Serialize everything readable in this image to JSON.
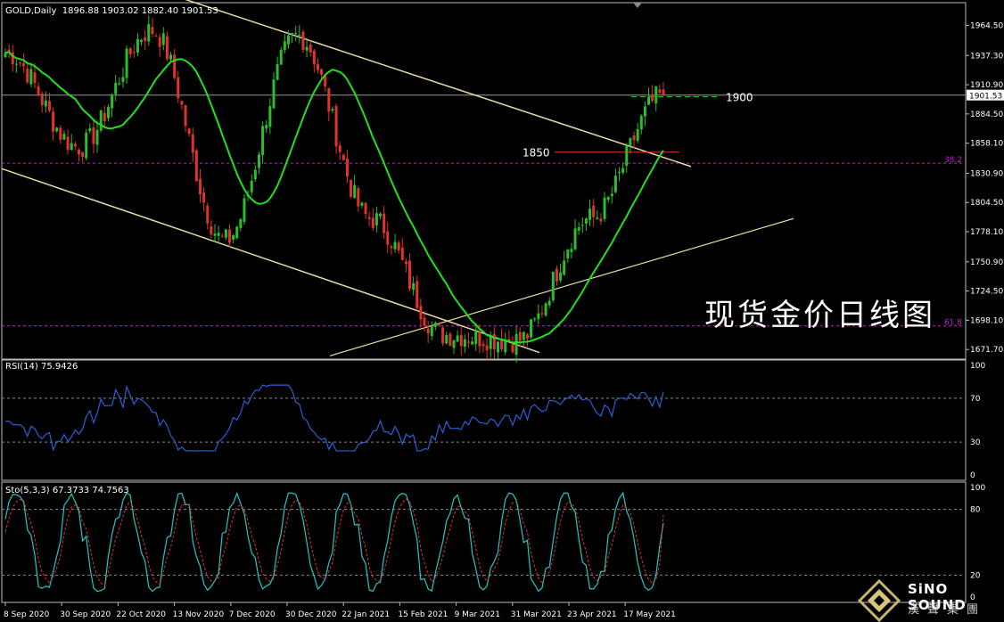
{
  "header": {
    "main": "GOLD,Daily  1896.88 1903.02 1882.40 1901.53",
    "rsi": "RSI(14) 75.9426",
    "sto": "Sto(5,3,3) 67.3733 74.7563"
  },
  "annotation_title": "现货金价日线图",
  "logo": {
    "name": "SiNO SOUND",
    "chinese": "漢聲集團"
  },
  "colors": {
    "background": "#000000",
    "bull_candle": "#2bbd2b",
    "bear_candle": "#e0332b",
    "ma": "#22e01e",
    "trend": "#e6dca0",
    "rsi": "#2a5fd6",
    "sto_main": "#20c8c8",
    "sto_signal": "#e03030",
    "fib": "#c020c0"
  },
  "chart_data": [
    {
      "type": "candlestick",
      "title": "GOLD,Daily",
      "ohlc_last": {
        "open": 1896.88,
        "high": 1903.02,
        "low": 1882.4,
        "close": 1901.53
      },
      "ylim": [
        1663,
        1985
      ],
      "y_ticks": [
        "1964.50",
        "1937.30",
        "1910.90",
        "1884.50",
        "1858.10",
        "1830.90",
        "1804.50",
        "1778.10",
        "1750.90",
        "1724.50",
        "1698.10",
        "1671.70"
      ],
      "x_ticks": [
        "8 Sep 2020",
        "30 Sep 2020",
        "22 Oct 2020",
        "13 Nov 2020",
        "7 Dec 2020",
        "30 Dec 2020",
        "22 Jan 2021",
        "15 Feb 2021",
        "9 Mar 2021",
        "31 Mar 2021",
        "23 Apr 2021",
        "17 May 2021"
      ],
      "current_price": "1901.53",
      "levels": [
        {
          "label": "1900",
          "value": 1900
        },
        {
          "label": "1850",
          "value": 1850
        }
      ],
      "fib_levels": [
        {
          "label": "38.2",
          "value": 1840
        },
        {
          "label": "61.8",
          "value": 1693
        }
      ],
      "key_prices": [
        {
          "date": "8 Sep 2020",
          "price": 1940
        },
        {
          "date": "Late Sep 2020",
          "price": 1855
        },
        {
          "date": "Early Nov 2020",
          "price": 1960
        },
        {
          "date": "Late Nov 2020",
          "price": 1770
        },
        {
          "date": "6 Jan 2021",
          "price": 1955
        },
        {
          "date": "Early Feb 2021",
          "price": 1790
        },
        {
          "date": "8 Mar 2021",
          "price": 1685
        },
        {
          "date": "31 Mar 2021",
          "price": 1680
        },
        {
          "date": "Late Apr 2021",
          "price": 1790
        },
        {
          "date": "21 May 2021",
          "price": 1901.53
        }
      ]
    },
    {
      "type": "line",
      "title": "RSI(14) 75.9426",
      "ylim": [
        0,
        100
      ],
      "y_ticks": [
        "100",
        "70",
        "30",
        "0"
      ],
      "last_value": 75.9426
    },
    {
      "type": "line",
      "title": "Sto(5,3,3) 67.3733 74.7563",
      "ylim": [
        0,
        100
      ],
      "y_ticks": [
        "100",
        "80",
        "20",
        "0"
      ],
      "main_last": 67.3733,
      "signal_last": 74.7563
    }
  ]
}
